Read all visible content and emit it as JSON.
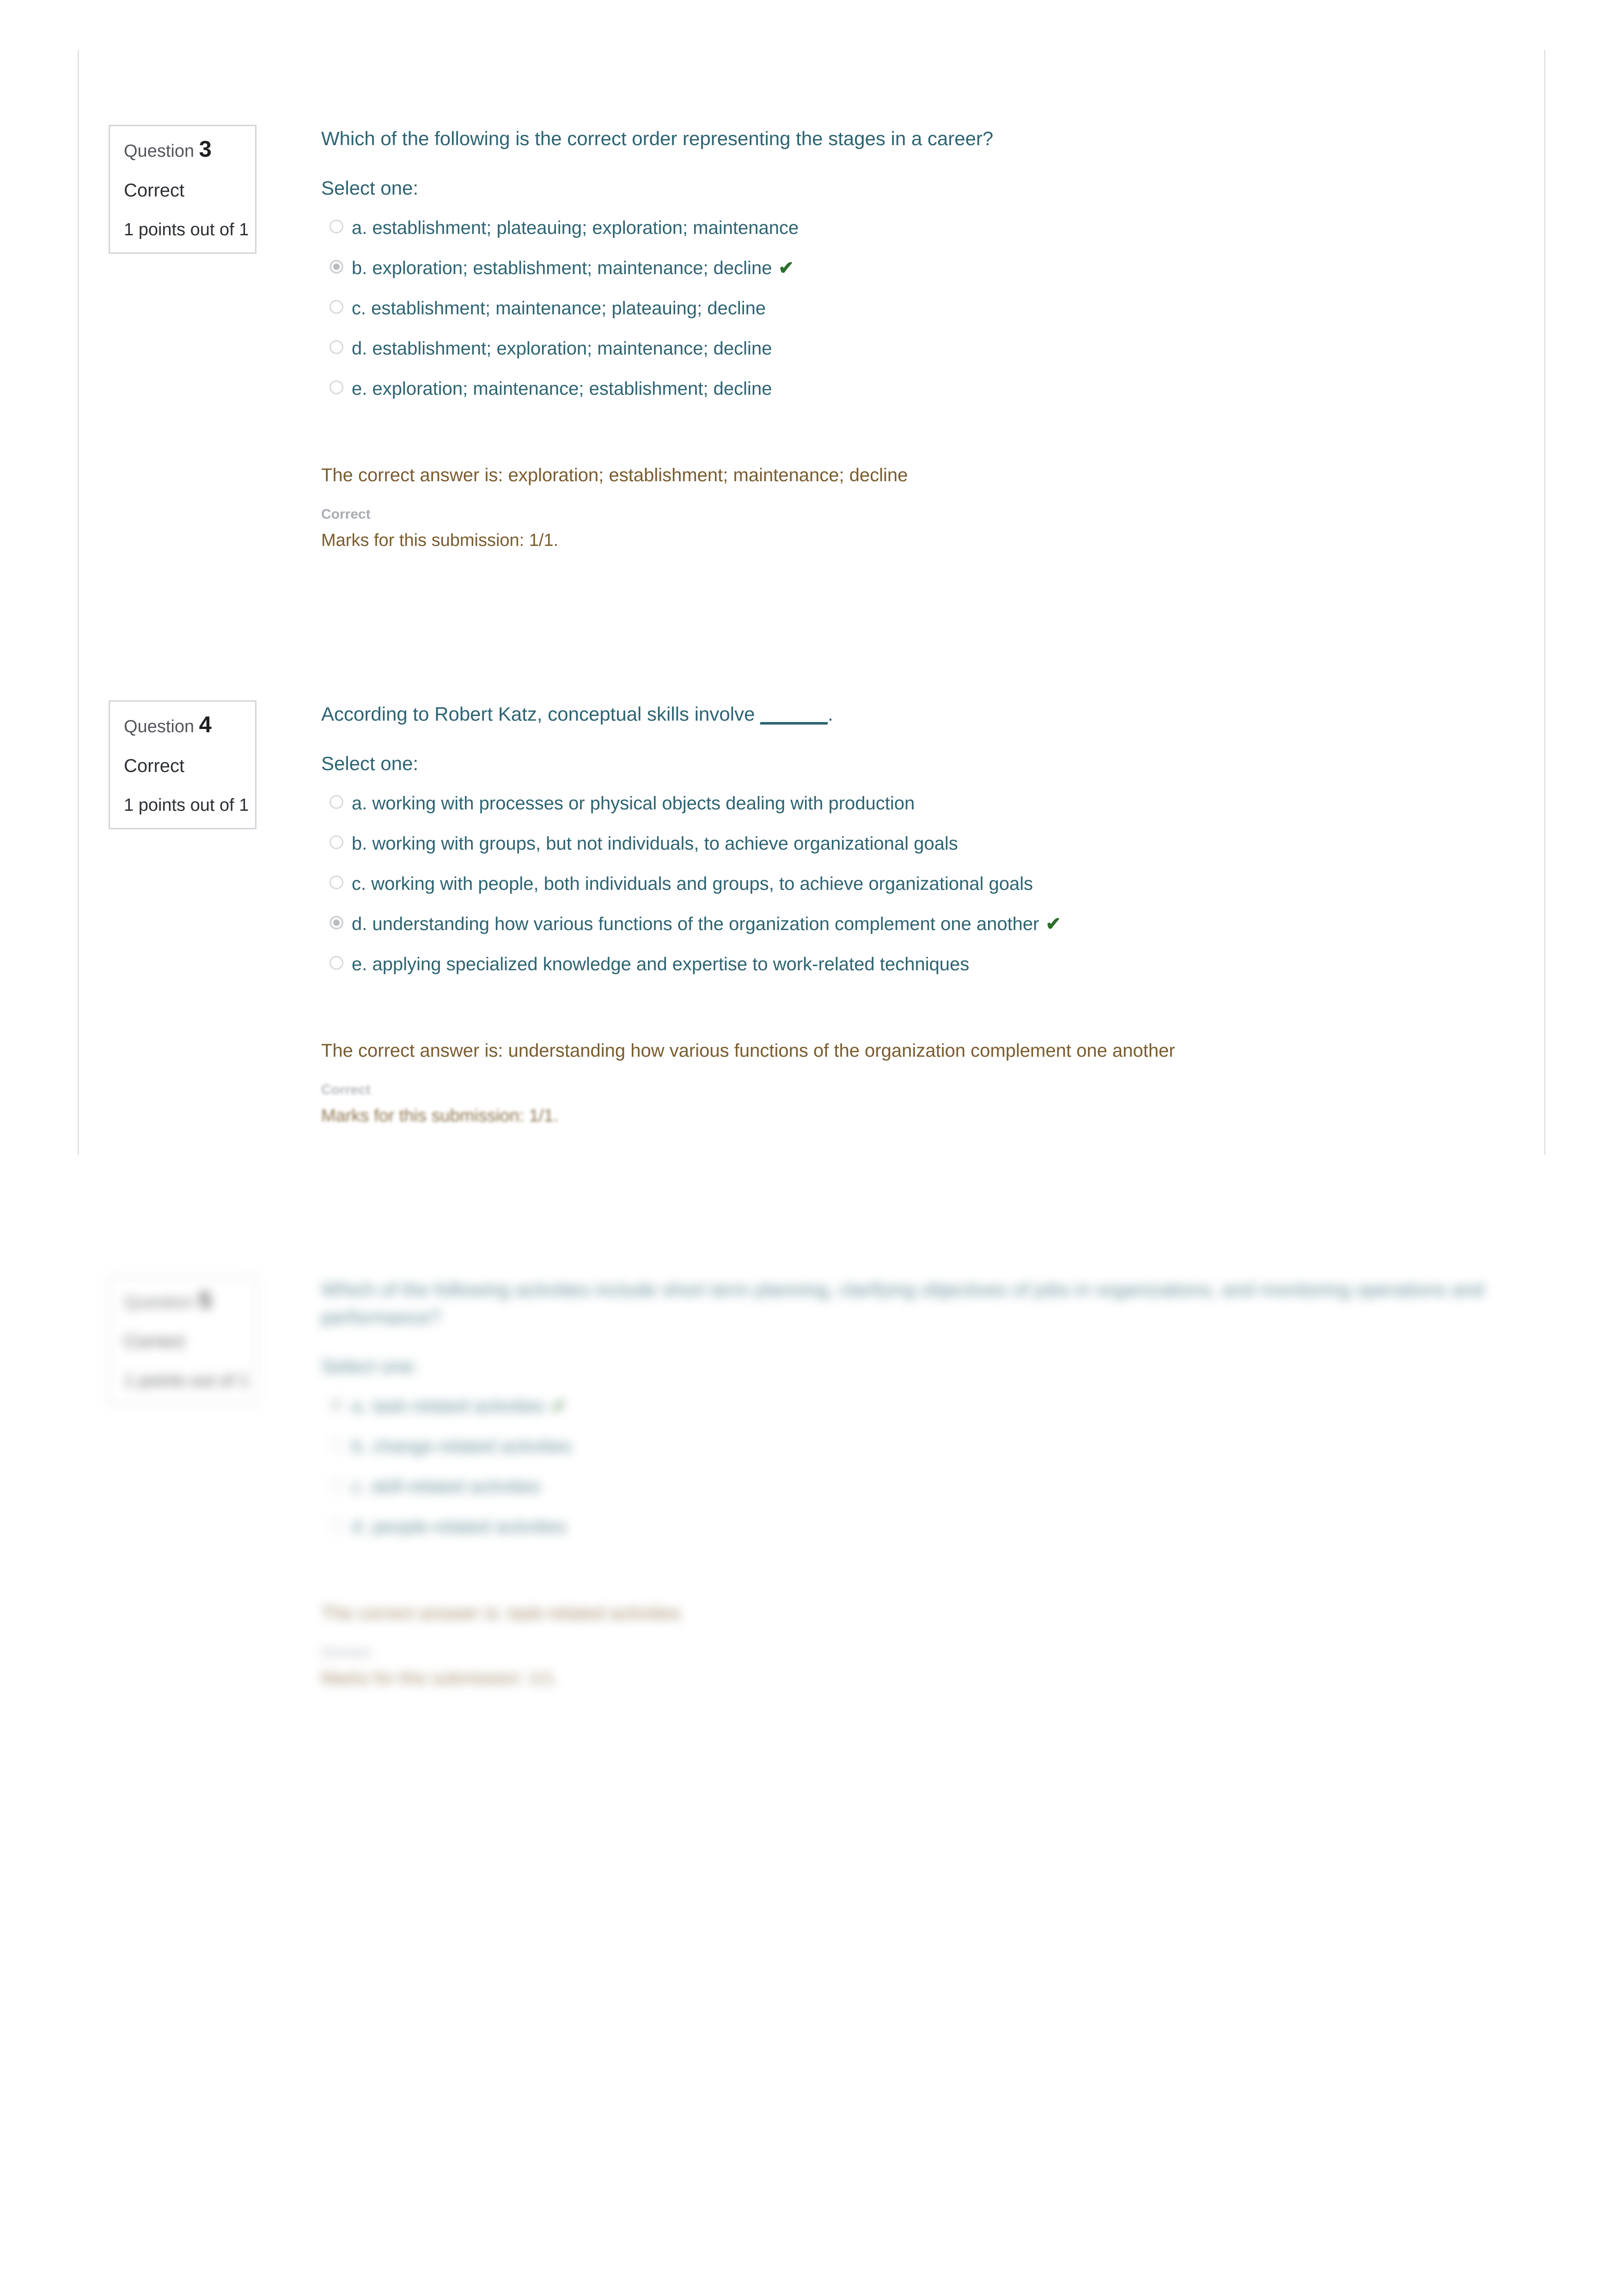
{
  "document": {
    "type": "quiz-review",
    "checkmark_glyph": "✔",
    "colors": {
      "question_text": "#2d6472",
      "feedback_text": "#7a5c2e",
      "state_label": "#a8adb3",
      "checkmark": "#2c6e2c",
      "border": "#d3d5da"
    }
  },
  "questions": [
    {
      "info": {
        "label": "Question",
        "number": "3",
        "state": "Correct",
        "grade": "1 points out of 1"
      },
      "text": "Which of the following is the correct order representing the stages in a career?",
      "select_prompt": "Select one:",
      "options": [
        {
          "letter": "a.",
          "label": "a. establishment; plateauing; exploration; maintenance",
          "selected": false,
          "correct": false
        },
        {
          "letter": "b.",
          "label": "b. exploration; establishment; maintenance; decline",
          "selected": true,
          "correct": true
        },
        {
          "letter": "c.",
          "label": "c. establishment; maintenance; plateauing; decline",
          "selected": false,
          "correct": false
        },
        {
          "letter": "d.",
          "label": "d. establishment; exploration; maintenance; decline",
          "selected": false,
          "correct": false
        },
        {
          "letter": "e.",
          "label": "e. exploration; maintenance; establishment; decline",
          "selected": false,
          "correct": false
        }
      ],
      "feedback": {
        "correct_answer": "The correct answer is: exploration; establishment; maintenance; decline",
        "state": "Correct",
        "marks": "Marks for this submission: 1/1."
      }
    },
    {
      "info": {
        "label": "Question",
        "number": "4",
        "state": "Correct",
        "grade": "1 points out of 1"
      },
      "text_before_blank": "According to Robert Katz, conceptual skills involve ",
      "blank": "______",
      "text_after_blank": ".",
      "select_prompt": "Select one:",
      "options": [
        {
          "letter": "a.",
          "label": "a. working with processes or physical objects dealing with production",
          "selected": false,
          "correct": false
        },
        {
          "letter": "b.",
          "label": "b. working with groups, but not individuals, to achieve organizational goals",
          "selected": false,
          "correct": false
        },
        {
          "letter": "c.",
          "label": "c. working with people, both individuals and groups, to achieve organizational goals",
          "selected": false,
          "correct": false
        },
        {
          "letter": "d.",
          "label": "d. understanding how various functions of the organization complement one another",
          "selected": true,
          "correct": true
        },
        {
          "letter": "e.",
          "label": "e. applying specialized knowledge and expertise to work-related techniques",
          "selected": false,
          "correct": false
        }
      ],
      "feedback": {
        "correct_answer": "The correct answer is: understanding how various functions of the organization complement one another",
        "state": "Correct",
        "marks": "Marks for this submission: 1/1."
      }
    },
    {
      "info": {
        "label": "Question",
        "number": "5",
        "state": "Correct",
        "grade": "1 points out of 1"
      },
      "text": "Which of the following activities include short term planning, clarifying objectives of jobs in organizations, and monitoring operations and performance?",
      "select_prompt": "Select one:",
      "options": [
        {
          "letter": "a.",
          "label": "a. task-related activities",
          "selected": true,
          "correct": true
        },
        {
          "letter": "b.",
          "label": "b. change-related activities",
          "selected": false,
          "correct": false
        },
        {
          "letter": "c.",
          "label": "c. skill-related activities",
          "selected": false,
          "correct": false
        },
        {
          "letter": "d.",
          "label": "d. people-related activities",
          "selected": false,
          "correct": false
        }
      ],
      "feedback": {
        "correct_answer": "The correct answer is: task-related activities",
        "state": "Correct",
        "marks": "Marks for this submission: 1/1."
      }
    }
  ]
}
